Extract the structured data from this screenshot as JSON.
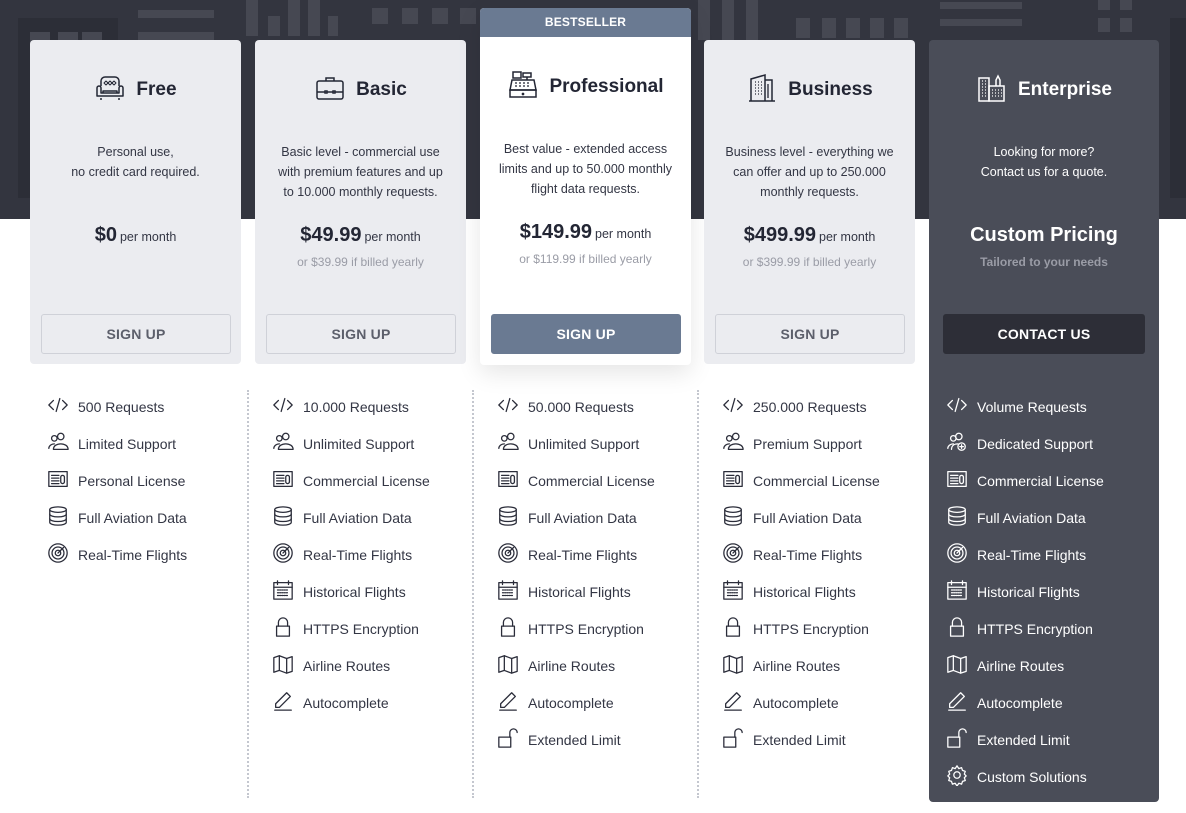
{
  "colors": {
    "hero_bg": "#33353f",
    "card_bg": "#ebecf0",
    "accent": "#6a7a92",
    "enterprise_bg": "#4a4d58",
    "contact_button": "#2d2e37",
    "muted_text": "#9a9ca6"
  },
  "plans": [
    {
      "name": "Free",
      "icon": "armchair-icon",
      "desc_lines": [
        "Personal use,",
        "no credit card required."
      ],
      "price": "$0",
      "per": "per month",
      "yearly": "",
      "button": "SIGN UP"
    },
    {
      "name": "Basic",
      "icon": "briefcase-icon",
      "desc_lines": [
        "Basic level - commercial use",
        "with premium features and up",
        "to 10.000 monthly requests."
      ],
      "price": "$49.99",
      "per": "per month",
      "yearly": "or $39.99 if billed yearly",
      "button": "SIGN UP"
    },
    {
      "name": "Professional",
      "badge": "BESTSELLER",
      "icon": "cash-register-icon",
      "desc_lines": [
        "Best value - extended access",
        "limits and up to 50.000 monthly",
        "flight data requests."
      ],
      "price": "$149.99",
      "per": "per month",
      "yearly": "or $119.99 if billed yearly",
      "button": "SIGN UP"
    },
    {
      "name": "Business",
      "icon": "office-building-icon",
      "desc_lines": [
        "Business level - everything we",
        "can offer and up to 250.000",
        "monthly requests."
      ],
      "price": "$499.99",
      "per": "per month",
      "yearly": "or $399.99 if billed yearly",
      "button": "SIGN UP"
    },
    {
      "name": "Enterprise",
      "icon": "city-buildings-icon",
      "desc_lines": [
        "Looking for more?",
        "Contact us for a quote."
      ],
      "price": "Custom Pricing",
      "yearly": "Tailored to your needs",
      "button": "CONTACT US"
    }
  ],
  "features": [
    [
      {
        "icon": "code-icon",
        "label": "500 Requests"
      },
      {
        "icon": "users-icon",
        "label": "Limited Support"
      },
      {
        "icon": "license-icon",
        "label": "Personal License"
      },
      {
        "icon": "database-icon",
        "label": "Full Aviation Data"
      },
      {
        "icon": "radar-icon",
        "label": "Real-Time Flights"
      }
    ],
    [
      {
        "icon": "code-icon",
        "label": "10.000 Requests"
      },
      {
        "icon": "users-icon",
        "label": "Unlimited Support"
      },
      {
        "icon": "license-icon",
        "label": "Commercial License"
      },
      {
        "icon": "database-icon",
        "label": "Full Aviation Data"
      },
      {
        "icon": "radar-icon",
        "label": "Real-Time Flights"
      },
      {
        "icon": "calendar-icon",
        "label": "Historical Flights"
      },
      {
        "icon": "lock-icon",
        "label": "HTTPS Encryption"
      },
      {
        "icon": "map-icon",
        "label": "Airline Routes"
      },
      {
        "icon": "pencil-icon",
        "label": "Autocomplete"
      }
    ],
    [
      {
        "icon": "code-icon",
        "label": "50.000 Requests"
      },
      {
        "icon": "users-icon",
        "label": "Unlimited Support"
      },
      {
        "icon": "license-icon",
        "label": "Commercial License"
      },
      {
        "icon": "database-icon",
        "label": "Full Aviation Data"
      },
      {
        "icon": "radar-icon",
        "label": "Real-Time Flights"
      },
      {
        "icon": "calendar-icon",
        "label": "Historical Flights"
      },
      {
        "icon": "lock-icon",
        "label": "HTTPS Encryption"
      },
      {
        "icon": "map-icon",
        "label": "Airline Routes"
      },
      {
        "icon": "pencil-icon",
        "label": "Autocomplete"
      },
      {
        "icon": "unlock-icon",
        "label": "Extended Limit"
      }
    ],
    [
      {
        "icon": "code-icon",
        "label": "250.000 Requests"
      },
      {
        "icon": "users-icon",
        "label": "Premium Support"
      },
      {
        "icon": "license-icon",
        "label": "Commercial License"
      },
      {
        "icon": "database-icon",
        "label": "Full Aviation Data"
      },
      {
        "icon": "radar-icon",
        "label": "Real-Time Flights"
      },
      {
        "icon": "calendar-icon",
        "label": "Historical Flights"
      },
      {
        "icon": "lock-icon",
        "label": "HTTPS Encryption"
      },
      {
        "icon": "map-icon",
        "label": "Airline Routes"
      },
      {
        "icon": "pencil-icon",
        "label": "Autocomplete"
      },
      {
        "icon": "unlock-icon",
        "label": "Extended Limit"
      }
    ],
    [
      {
        "icon": "code-icon",
        "label": "Volume Requests"
      },
      {
        "icon": "users-plus-icon",
        "label": "Dedicated Support"
      },
      {
        "icon": "license-icon",
        "label": "Commercial License"
      },
      {
        "icon": "database-icon",
        "label": "Full Aviation Data"
      },
      {
        "icon": "radar-icon",
        "label": "Real-Time Flights"
      },
      {
        "icon": "calendar-icon",
        "label": "Historical Flights"
      },
      {
        "icon": "lock-icon",
        "label": "HTTPS Encryption"
      },
      {
        "icon": "map-icon",
        "label": "Airline Routes"
      },
      {
        "icon": "pencil-icon",
        "label": "Autocomplete"
      },
      {
        "icon": "unlock-icon",
        "label": "Extended Limit"
      },
      {
        "icon": "gear-icon",
        "label": "Custom Solutions"
      }
    ]
  ]
}
